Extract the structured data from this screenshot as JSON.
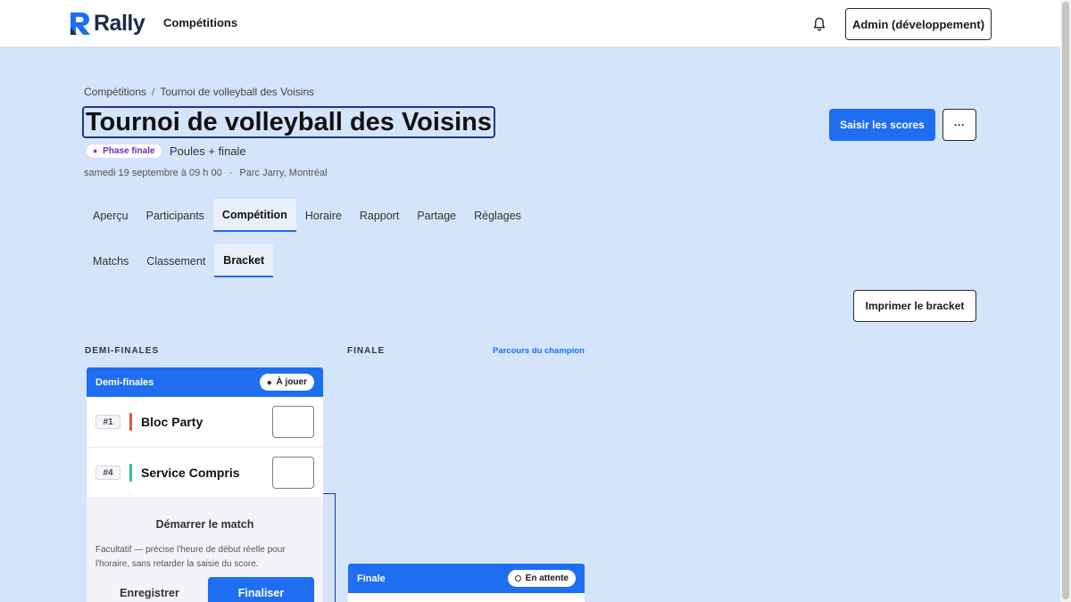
{
  "app": {
    "name": "Rally"
  },
  "nav": {
    "competitions": "Compétitions"
  },
  "admin": {
    "label": "Admin (développement)"
  },
  "breadcrumb": {
    "root": "Compétitions",
    "separator": "/",
    "current": "Tournoi de volleyball des Voisins"
  },
  "page": {
    "title": "Tournoi de volleyball des Voisins",
    "phase_badge": "Phase finale",
    "format": "Poules + finale",
    "date": "samedi 19 septembre à 09 h 00",
    "meta_separator": "·",
    "location": "Parc Jarry, Montréal"
  },
  "actions": {
    "enter_scores": "Saisir les scores",
    "more": "···",
    "print_bracket": "Imprimer le bracket"
  },
  "tabs": [
    {
      "label": "Aperçu",
      "active": false
    },
    {
      "label": "Participants",
      "active": false
    },
    {
      "label": "Compétition",
      "active": true
    },
    {
      "label": "Horaire",
      "active": false
    },
    {
      "label": "Rapport",
      "active": false
    },
    {
      "label": "Partage",
      "active": false
    },
    {
      "label": "Réglages",
      "active": false
    }
  ],
  "subtabs": [
    {
      "label": "Matchs",
      "active": false
    },
    {
      "label": "Classement",
      "active": false
    },
    {
      "label": "Bracket",
      "active": true
    }
  ],
  "bracket": {
    "col_semis": "DEMI-FINALES",
    "col_final": "FINALE",
    "champion_path": "Parcours du champion",
    "semi_card": {
      "name": "Demi-finales",
      "status": "À jouer",
      "teams": [
        {
          "seed": "#1",
          "name": "Bloc Party",
          "color": "#e5553b"
        },
        {
          "seed": "#4",
          "name": "Service Compris",
          "color": "#2ec48e"
        }
      ],
      "start_title": "Démarrer le match",
      "start_note": "Facultatif — précise l'heure de début réelle pour l'horaire, sans retarder la saisie du score.",
      "save": "Enregistrer",
      "finalize": "Finaliser"
    },
    "final_card": {
      "name": "Finale",
      "status": "En attente"
    }
  },
  "colors": {
    "accent": "#1f6ef2",
    "background": "#d4e4fb",
    "phase": "#6b2fa6"
  }
}
